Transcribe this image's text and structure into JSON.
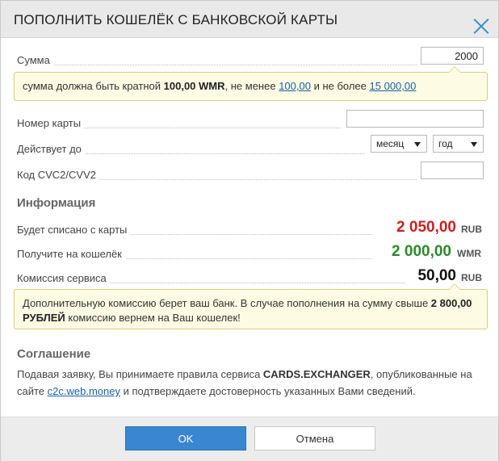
{
  "dialog": {
    "title": "ПОПОЛНИТЬ КОШЕЛЁК С БАНКОВСКОЙ КАРТЫ"
  },
  "form": {
    "amount_label": "Сумма",
    "amount_value": "2000",
    "amount_hint": {
      "text_before": "сумма должна быть кратной ",
      "multiple": "100,00 WMR",
      "text_mid": ", не менее ",
      "min": "100,00",
      "text_mid2": " и не более ",
      "max": "15 000,00"
    },
    "card_number_label": "Номер карты",
    "card_number_value": "",
    "valid_until_label": "Действует до",
    "month_selected": "месяц",
    "year_selected": "год",
    "cvc_label": "Код CVC2/CVV2",
    "cvc_value": ""
  },
  "info": {
    "heading": "Информация",
    "rows": [
      {
        "label": "Будет списано с карты",
        "amount": "2 050,00",
        "currency": "RUB",
        "color": "#cc1f1f"
      },
      {
        "label": "Получите на кошелёк",
        "amount": "2 000,00",
        "currency": "WMR",
        "color": "#2a8a2a"
      },
      {
        "label": "Комиссия сервиса",
        "amount": "50,00",
        "currency": "RUB",
        "color": "#111111"
      }
    ],
    "note": {
      "text_before": "Дополнительную комиссию берет ваш банк. В случае пополнения на сумму свыше ",
      "threshold": "2 800,00 РУБЛЕЙ",
      "text_after": " комиссию вернем на Ваш кошелек!"
    }
  },
  "agreement": {
    "heading": "Соглашение",
    "text_before": "Подавая заявку, Вы принимаете правила сервиса ",
    "service": "CARDS.EXCHANGER",
    "text_mid": ", опубликованные на сайте ",
    "link": "c2c.web.money",
    "text_after": " и подтверждаете достоверность указанных Вами сведений."
  },
  "buttons": {
    "ok": "OK",
    "cancel": "Отмена"
  },
  "colors": {
    "accent": "#3a86d0",
    "hint_bg": "#fdfbe3"
  },
  "icons": {
    "close": "close-icon"
  }
}
